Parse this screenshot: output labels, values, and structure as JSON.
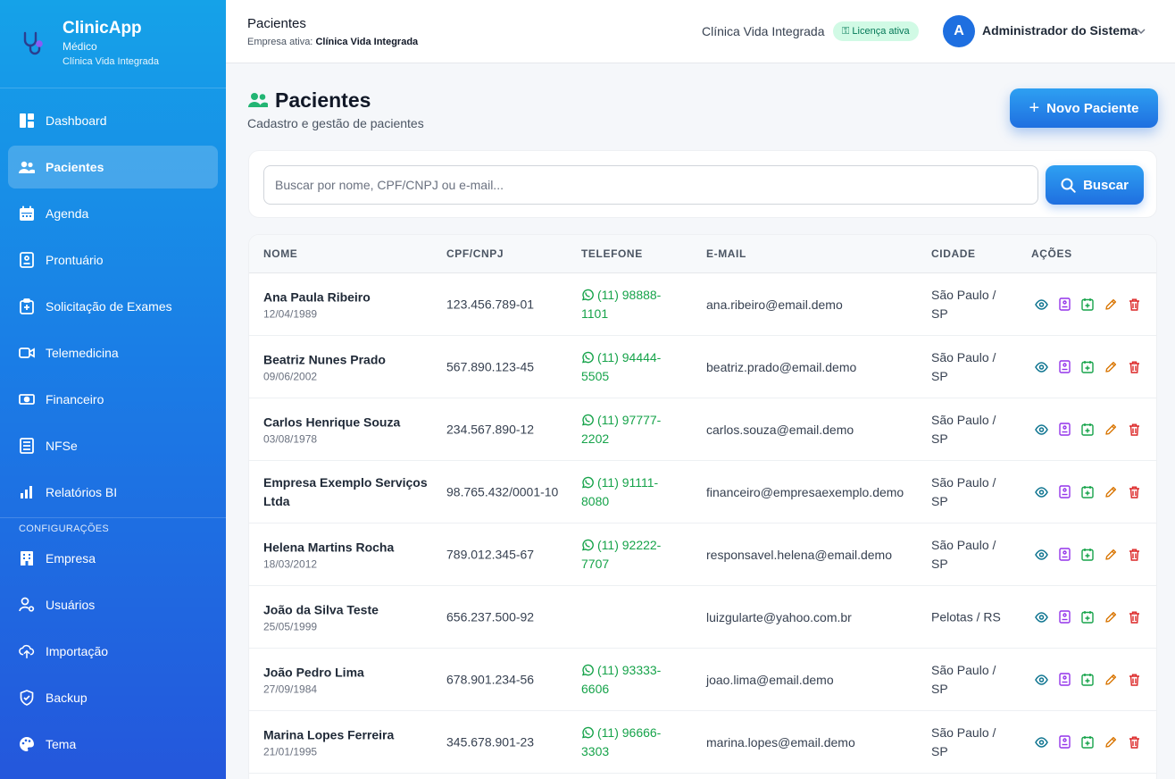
{
  "sidebar": {
    "app_name": "ClinicApp",
    "role": "Médico",
    "clinic": "Clínica Vida Integrada",
    "items": [
      {
        "label": "Dashboard",
        "icon": "dashboard-icon"
      },
      {
        "label": "Pacientes",
        "icon": "users-icon",
        "active": true
      },
      {
        "label": "Agenda",
        "icon": "calendar-icon"
      },
      {
        "label": "Prontuário",
        "icon": "record-icon"
      },
      {
        "label": "Solicitação de Exames",
        "icon": "clipboard-icon"
      },
      {
        "label": "Telemedicina",
        "icon": "video-icon"
      },
      {
        "label": "Financeiro",
        "icon": "money-icon"
      },
      {
        "label": "NFSe",
        "icon": "invoice-icon"
      },
      {
        "label": "Relatórios BI",
        "icon": "chart-icon"
      }
    ],
    "section_label": "CONFIGURAÇÕES",
    "config_items": [
      {
        "label": "Empresa",
        "icon": "building-icon"
      },
      {
        "label": "Usuários",
        "icon": "user-gear-icon"
      },
      {
        "label": "Importação",
        "icon": "upload-cloud-icon"
      },
      {
        "label": "Backup",
        "icon": "shield-icon"
      },
      {
        "label": "Tema",
        "icon": "palette-icon"
      }
    ]
  },
  "topbar": {
    "page_title": "Pacientes",
    "empresa_label": "Empresa ativa:",
    "empresa_value": "Clínica Vida Integrada",
    "clinic_name": "Clínica Vida Integrada",
    "license_badge": "⚿ Licença ativa",
    "avatar_letter": "A",
    "user_name": "Administrador do Sistema"
  },
  "page": {
    "title": "Pacientes",
    "subtitle": "Cadastro e gestão de pacientes",
    "new_button": "Novo Paciente",
    "new_button_plus": "+"
  },
  "search": {
    "placeholder": "Buscar por nome, CPF/CNPJ ou e-mail...",
    "value": "",
    "button": "Buscar"
  },
  "table": {
    "columns": [
      "NOME",
      "CPF/CNPJ",
      "TELEFONE",
      "E-MAIL",
      "CIDADE",
      "AÇÕES"
    ],
    "rows": [
      {
        "name": "Ana Paula Ribeiro",
        "date": "12/04/1989",
        "doc": "123.456.789-01",
        "phone": "(11) 98888-1101",
        "email": "ana.ribeiro@email.demo",
        "city": "São Paulo / SP"
      },
      {
        "name": "Beatriz Nunes Prado",
        "date": "09/06/2002",
        "doc": "567.890.123-45",
        "phone": "(11) 94444-5505",
        "email": "beatriz.prado@email.demo",
        "city": "São Paulo / SP"
      },
      {
        "name": "Carlos Henrique Souza",
        "date": "03/08/1978",
        "doc": "234.567.890-12",
        "phone": "(11) 97777-2202",
        "email": "carlos.souza@email.demo",
        "city": "São Paulo / SP"
      },
      {
        "name": "Empresa Exemplo Serviços Ltda",
        "date": "",
        "doc": "98.765.432/0001-10",
        "phone": "(11) 91111-8080",
        "email": "financeiro@empresaexemplo.demo",
        "city": "São Paulo / SP"
      },
      {
        "name": "Helena Martins Rocha",
        "date": "18/03/2012",
        "doc": "789.012.345-67",
        "phone": "(11) 92222-7707",
        "email": "responsavel.helena@email.demo",
        "city": "São Paulo / SP"
      },
      {
        "name": "João da Silva Teste",
        "date": "25/05/1999",
        "doc": "656.237.500-92",
        "phone": "",
        "email": "luizgularte@yahoo.com.br",
        "city": "Pelotas / RS"
      },
      {
        "name": "João Pedro Lima",
        "date": "27/09/1984",
        "doc": "678.901.234-56",
        "phone": "(11) 93333-6606",
        "email": "joao.lima@email.demo",
        "city": "São Paulo / SP"
      },
      {
        "name": "Marina Lopes Ferreira",
        "date": "21/01/1995",
        "doc": "345.678.901-23",
        "phone": "(11) 96666-3303",
        "email": "marina.lopes@email.demo",
        "city": "São Paulo / SP"
      }
    ],
    "actions": [
      {
        "name": "view-icon",
        "color": "#0e7490"
      },
      {
        "name": "record-icon",
        "color": "#9333ea"
      },
      {
        "name": "calendar-add-icon",
        "color": "#16a34a"
      },
      {
        "name": "edit-icon",
        "color": "#d97706"
      },
      {
        "name": "trash-icon",
        "color": "#dc2626"
      }
    ]
  },
  "colors": {
    "accent": "#1f6fe0",
    "whatsapp": "#16a34a",
    "license_bg": "#d1fae5"
  }
}
